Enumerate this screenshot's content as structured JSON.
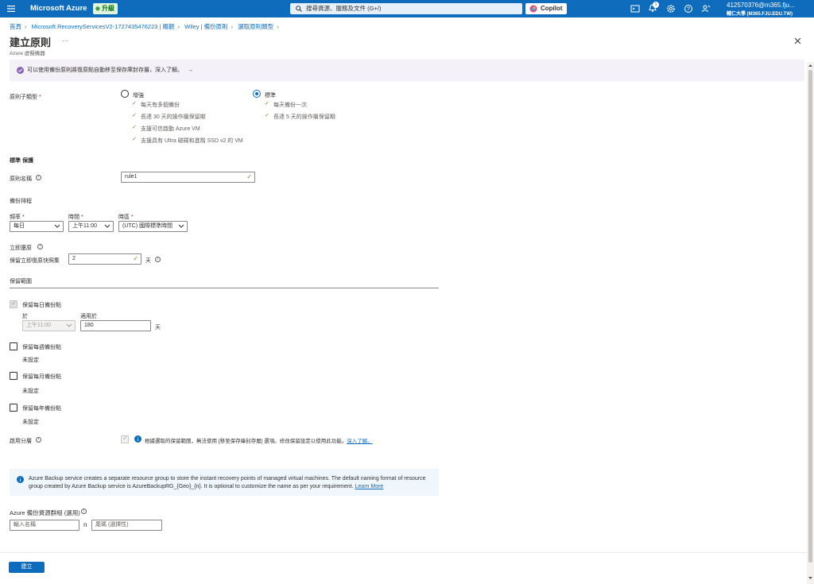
{
  "topbar": {
    "brand": "Microsoft Azure",
    "upgrade_label": "升級",
    "search_placeholder": "搜尋資源、服務及文件 (G+/)",
    "copilot_label": "Copilot",
    "notification_count": "1",
    "account_name": "412570376@m365.fju...",
    "account_org": "輔仁大學 (M365.FJU.EDU.TW)"
  },
  "breadcrumb": [
    "首頁",
    "Microsoft.RecoveryServicesV2-1727435476223 | 概觀",
    "Wiley | 備份原則",
    "選取原則類型"
  ],
  "page": {
    "title": "建立原則",
    "more": "···",
    "subtitle": "Azure 虛擬機器"
  },
  "banner": {
    "text": "可以使用備份原則將復原點自動移至保存庫封存層，深入了解。",
    "arrow": "→"
  },
  "policy_subtype": {
    "label": "原則子類型",
    "required": "*",
    "enhanced": {
      "label": "增強",
      "features": [
        "每天有多個備份",
        "長達 30 天的操作層保留期",
        "支援可信啟動 Azure VM",
        "支援具有 Ultra 磁碟和進階 SSD v2 的 VM"
      ]
    },
    "standard": {
      "label": "標準",
      "features": [
        "每天備份一次",
        "長達 5 天的操作層保留期"
      ]
    }
  },
  "section_standard": "標準 保護",
  "policy_name": {
    "label": "原則名稱",
    "value": "rule1"
  },
  "backup_schedule": {
    "heading": "備份排程",
    "frequency": {
      "label": "頻率",
      "value": "每日"
    },
    "time": {
      "label": "時間",
      "value": "上午11:00"
    },
    "timezone": {
      "label": "時區",
      "value": "(UTC) 國際標準時間"
    }
  },
  "instant_restore": {
    "heading": "立即還原",
    "label": "保留立即復原快照集",
    "value": "2",
    "unit": "天"
  },
  "retention": {
    "heading": "保留範圍",
    "daily": {
      "label": "保留每日備份點",
      "at_label": "於",
      "at_value": "上午11:00",
      "for_label": "適用於",
      "for_value": "180",
      "unit": "天"
    },
    "weekly": {
      "label": "保留每週備份點",
      "status": "未設定"
    },
    "monthly": {
      "label": "保留每月備份點",
      "status": "未設定"
    },
    "yearly": {
      "label": "保留每年備份點",
      "status": "未設定"
    }
  },
  "tiering": {
    "label": "啟用分層",
    "note": "根據選取的保留範圍，無法使用 [移至保存庫封存層] 選項。修改保留設定以使用此功能。",
    "link": "深入了解。"
  },
  "info": {
    "text": "Azure Backup service creates a separate resource group to store the instant recovery points of managed virtual machines. The default naming format of resource group created by Azure Backup service is AzureBackupRG_{Geo}_{n}. It is optional to customize the name as per your requirement.",
    "link": "Learn More"
  },
  "resource_group": {
    "label": "Azure 備份資源群組 (選用)",
    "name_placeholder": "輸入名稱",
    "separator": "n",
    "suffix_placeholder": "尾碼 (選擇性)"
  },
  "footer": {
    "create_label": "建立"
  }
}
